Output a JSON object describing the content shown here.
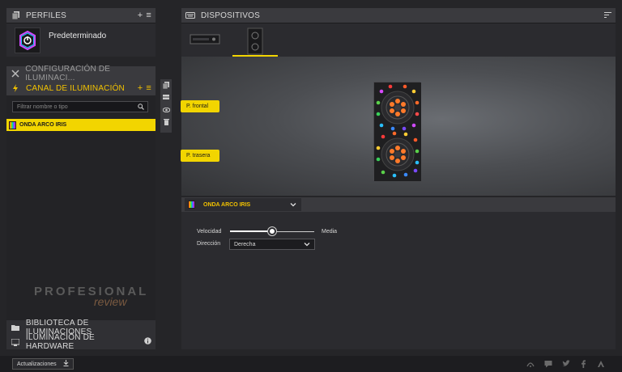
{
  "profiles": {
    "header": "PERFILES",
    "add_icon": "plus-icon",
    "menu_icon": "menu-icon",
    "items": [
      {
        "name": "Predeterminado"
      }
    ]
  },
  "left_nav": {
    "config_label": "CONFIGURACIÓN DE ILUMINACI...",
    "channel_label": "CANAL DE ILUMINACIÓN",
    "filter_placeholder": "Filtrar nombre o tipo",
    "effects": [
      {
        "name": "ONDA ARCO IRIS",
        "selected": true
      }
    ],
    "library_label": "BIBLIOTECA DE ILUMINACIONES",
    "hardware_label": "ILUMINACIÓN DE HARDWARE"
  },
  "devices": {
    "header": "DISPOSITIVOS",
    "zones": [
      "P. frontal",
      "P. trasera"
    ]
  },
  "effect_panel": {
    "effect_name": "ONDA ARCO IRIS",
    "speed_label": "Velocidad",
    "speed_value_label": "Media",
    "speed_level": 0.5,
    "direction_label": "Dirección",
    "direction_value": "Derecha"
  },
  "watermark": {
    "line1": "PROFESIONAL",
    "line2": "review"
  },
  "footer": {
    "updates_label": "Actualizaciones"
  },
  "colors": {
    "accent": "#f2d500",
    "panel": "#3a3a3e",
    "background": "#252528"
  }
}
